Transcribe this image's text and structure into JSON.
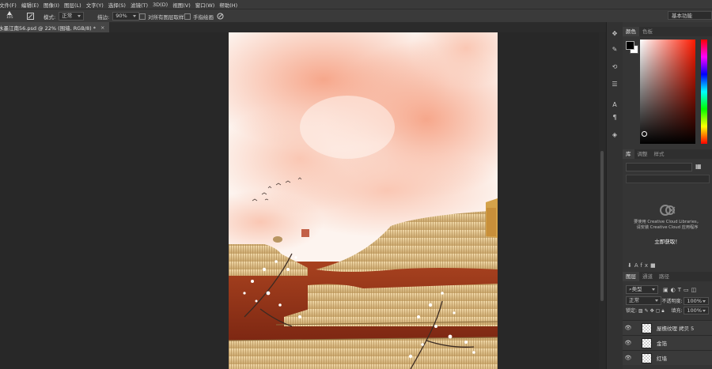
{
  "menu": [
    "文件(F)",
    "编辑(E)",
    "图像(I)",
    "图层(L)",
    "文字(Y)",
    "选择(S)",
    "滤镜(T)",
    "3D(D)",
    "视图(V)",
    "窗口(W)",
    "帮助(H)"
  ],
  "options": {
    "tool_size": "105",
    "mode_label": "模式:",
    "mode_value": "正常",
    "opacity_label": "描边:",
    "opacity_value": "90%",
    "sample_all_label": "对所有图层取样",
    "finger_paint_label": "手指绘画"
  },
  "workspace": "基本功能",
  "document_tab": {
    "title": "水墨江南56.psd @ 22% (围墙, RGB/8) *",
    "close": "×"
  },
  "color_panel": {
    "tabs": [
      "颜色",
      "色板"
    ],
    "foreground": "#000000",
    "background": "#ffffff",
    "hue_color": "#ff1a00"
  },
  "libraries_panel": {
    "tabs": [
      "库",
      "调整",
      "样式"
    ],
    "message_line1": "要使用 Creative Cloud Libraries，",
    "message_line2": "请安装 Creative Cloud 应用程序",
    "link": "立即获取！"
  },
  "layers_panel": {
    "tabs": [
      "图层",
      "通道",
      "路径"
    ],
    "filter_kind": "类型",
    "blend_mode": "正常",
    "opacity_label": "不透明度:",
    "opacity_value": "100%",
    "lock_label": "锁定:",
    "fill_label": "填充:",
    "fill_value": "100%",
    "layers": [
      {
        "name": "屋檐纹理 拷贝 5",
        "visible": true
      },
      {
        "name": "金箔",
        "visible": true
      },
      {
        "name": "红墙",
        "visible": true
      }
    ]
  },
  "icons": [
    "move-icon",
    "brush-icon",
    "history-icon",
    "type-icon",
    "paragraph-icon",
    "3d-icon"
  ]
}
